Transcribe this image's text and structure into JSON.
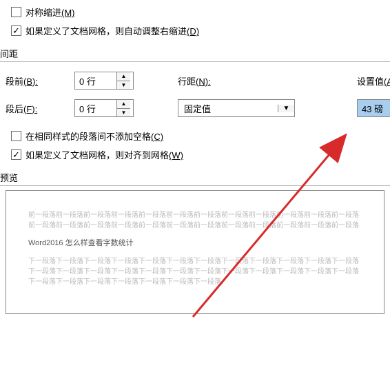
{
  "indent": {
    "mirror_label": "对称缩进",
    "mirror_accel": "(M)",
    "mirror_checked": false,
    "grid_adjust_label": "如果定义了文档网格，则自动调整右缩进",
    "grid_adjust_accel": "(D)",
    "grid_adjust_checked": true
  },
  "spacing": {
    "group_title": "间距",
    "before_label": "段前",
    "before_accel": "(B):",
    "before_value": "0 行",
    "after_label": "段后",
    "after_accel": "(F):",
    "after_value": "0 行",
    "line_spacing_label": "行距",
    "line_spacing_accel": "(N):",
    "line_spacing_value": "固定值",
    "set_at_label": "设置值",
    "set_at_accel": "(A):",
    "set_at_value": "43 磅",
    "no_space_label": "在相同样式的段落间不添加空格",
    "no_space_accel": "(C)",
    "no_space_checked": false,
    "snap_grid_label": "如果定义了文档网格，则对齐到网格",
    "snap_grid_accel": "(W)",
    "snap_grid_checked": true
  },
  "preview": {
    "group_title": "预览",
    "filler_before": "前一段落前一段落前一段落前一段落前一段落前一段落前一段落前一段落前一段落前一段落前一段落前一段落前一段落前一段落前一段落前一段落前一段落前一段落前一段落前一段落前一段落前一段落前一段落前一段落",
    "sample_text": "Word2016 怎么样查看字数统计",
    "filler_after": "下一段落下一段落下一段落下一段落下一段落下一段落下一段落下一段落下一段落下一段落下一段落下一段落下一段落下一段落下一段落下一段落下一段落下一段落下一段落下一段落下一段落下一段落下一段落下一段落下一段落下一段落下一段落下一段落下一段落下一段落下一段落"
  },
  "colors": {
    "highlight": "#a8cdee",
    "arrow": "#d82a2a"
  }
}
